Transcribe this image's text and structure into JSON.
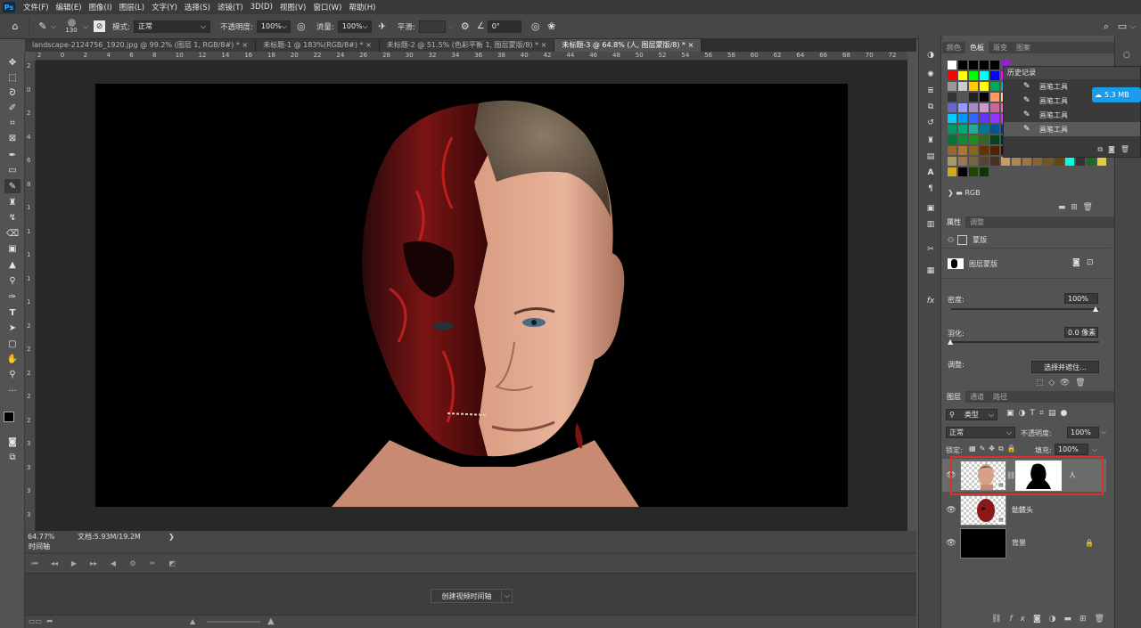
{
  "app": {
    "logo": "Ps"
  },
  "menu": [
    "文件(F)",
    "编辑(E)",
    "图像(I)",
    "图层(L)",
    "文字(Y)",
    "选择(S)",
    "滤镜(T)",
    "3D(D)",
    "视图(V)",
    "窗口(W)",
    "帮助(H)"
  ],
  "options": {
    "brush_size": "130",
    "mode_label": "模式:",
    "mode_value": "正常",
    "opacity_label": "不透明度:",
    "opacity_value": "100%",
    "flow_label": "流量:",
    "flow_value": "100%",
    "smooth_label": "平滑:",
    "angle_value": "0°"
  },
  "tabs": [
    {
      "label": "landscape-2124756_1920.jpg @ 99.2% (图层 1, RGB/8#) *",
      "active": false
    },
    {
      "label": "未标题-1 @ 183%(RGB/8#) *",
      "active": false
    },
    {
      "label": "未标题-2 @ 51.5% (色彩平衡 1, 图层蒙版/8) *",
      "active": false
    },
    {
      "label": "未标题-3 @ 64.8% (人, 图层蒙版/8) *",
      "active": true
    }
  ],
  "ruler_h": [
    "2",
    "0",
    "2",
    "4",
    "6",
    "8",
    "10",
    "12",
    "14",
    "16",
    "18",
    "20",
    "22",
    "24",
    "26",
    "28",
    "30",
    "32",
    "34",
    "36",
    "38",
    "40",
    "42",
    "44",
    "46",
    "48",
    "50",
    "52",
    "54",
    "56",
    "58",
    "60",
    "62",
    "64",
    "66",
    "68",
    "70",
    "72"
  ],
  "ruler_v": [
    "2",
    "0",
    "2",
    "4",
    "6",
    "8",
    "1",
    "1",
    "1",
    "1",
    "1",
    "2",
    "2",
    "2",
    "2",
    "2",
    "3",
    "3",
    "3",
    "3"
  ],
  "status": {
    "zoom": "64.77%",
    "doc": "文档:5.93M/19.2M",
    "arrow": "❯"
  },
  "timeline": {
    "title": "时间轴",
    "create_button": "创建视频时间轴",
    "dropdown": "⌵"
  },
  "swatch_panel": {
    "tabs": [
      "颜色",
      "色板",
      "渐变",
      "图案"
    ],
    "active_tab": "色板",
    "group_label": "RGB",
    "colors": [
      "#ffffff",
      "#000000",
      "#000000",
      "#000000",
      "#000000",
      "#9b1ae0",
      "#ff0000",
      "#ffff00",
      "#00ff00",
      "#00ffff",
      "#0000ff",
      "#ff00ff",
      "#999999",
      "#cccccc",
      "#ffcc00",
      "#ffff00",
      "#00aa55",
      "#00aadd",
      "#333333",
      "#555555",
      "#222222",
      "#000000",
      "#ff9966",
      "#ffcc99",
      "#6666cc",
      "#9999ff",
      "#aa88cc",
      "#cc99cc",
      "#cc6699",
      "#ff6699",
      "#00ccff",
      "#0099ff",
      "#3366ff",
      "#6633ff",
      "#9933ff",
      "#cc33ff",
      "#009966",
      "#00aa77",
      "#22aa99",
      "#007799",
      "#005599",
      "#003388",
      "#007733",
      "#118833",
      "#228822",
      "#336622",
      "#004422",
      "#003311",
      "#996633",
      "#aa7733",
      "#886622",
      "#663300",
      "#552200",
      "#331100",
      "#aa9966",
      "#997755",
      "#776644",
      "#554433",
      "#443322",
      "#332211",
      "#ccaa22",
      "#000000",
      "#224400",
      "#113300"
    ],
    "row_extra": [
      "#cc9966",
      "#aa8855",
      "#997744",
      "#886633",
      "#775522",
      "#664411",
      "#00ffdd",
      "#333333",
      "#226622",
      "#ddcc44"
    ]
  },
  "history": {
    "title": "历史记录",
    "items": [
      "画笔工具",
      "画笔工具",
      "画笔工具",
      "画笔工具"
    ],
    "selected": 3
  },
  "badge": "5.3 MB",
  "properties": {
    "tabs": [
      "属性",
      "调整"
    ],
    "mask_label": "蒙版",
    "layer_mask_label": "图层蒙版",
    "density_label": "密度:",
    "density_value": "100%",
    "feather_label": "羽化:",
    "feather_value": "0.0 像素",
    "adjust_label": "调整:",
    "select_mask_button": "选择并遮住..."
  },
  "layers": {
    "tabs": [
      "图层",
      "通道",
      "路径"
    ],
    "filter_kind": "类型",
    "blend_mode": "正常",
    "opacity_label": "不透明度:",
    "opacity_value": "100%",
    "lock_label": "锁定:",
    "fill_label": "填充:",
    "fill_value": "100%",
    "items": [
      {
        "name": "人",
        "selected": true
      },
      {
        "name": "骷髅头",
        "selected": false
      },
      {
        "name": "背景",
        "selected": false
      }
    ]
  },
  "colors": {
    "accent": "#1a9cea",
    "highlight": "#d8312e",
    "blood": "#b01818"
  }
}
